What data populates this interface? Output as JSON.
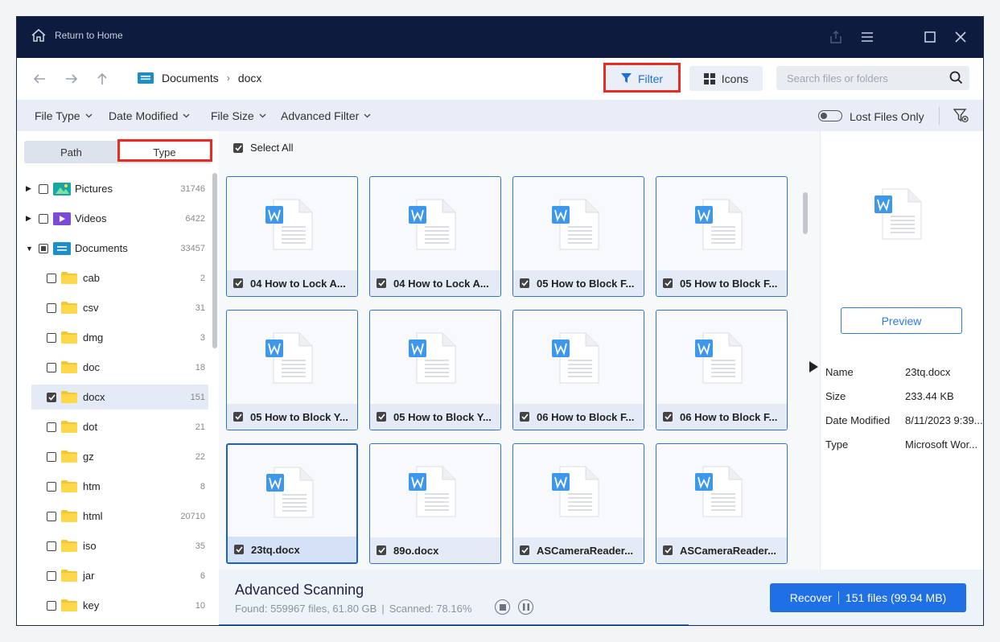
{
  "titlebar": {
    "home_label": "Return to Home"
  },
  "nav": {
    "breadcrumbs": [
      "Documents",
      "docx"
    ],
    "filter_label": "Filter",
    "icons_label": "Icons",
    "search_placeholder": "Search files or folders"
  },
  "filters": {
    "items": [
      "File Type",
      "Date Modified",
      "File Size",
      "Advanced Filter"
    ],
    "lost_files_only": "Lost Files Only"
  },
  "sidebar": {
    "tabs": [
      "Path",
      "Type"
    ],
    "active_tab": "Type",
    "tree": [
      {
        "label": "Pictures",
        "count": "31746"
      },
      {
        "label": "Videos",
        "count": "6422"
      },
      {
        "label": "Documents",
        "count": "33457"
      }
    ],
    "folders": [
      {
        "label": "cab",
        "count": "2"
      },
      {
        "label": "csv",
        "count": "31"
      },
      {
        "label": "dmg",
        "count": "3"
      },
      {
        "label": "doc",
        "count": "18"
      },
      {
        "label": "docx",
        "count": "151"
      },
      {
        "label": "dot",
        "count": "21"
      },
      {
        "label": "gz",
        "count": "22"
      },
      {
        "label": "htm",
        "count": "8"
      },
      {
        "label": "html",
        "count": "20710"
      },
      {
        "label": "iso",
        "count": "35"
      },
      {
        "label": "jar",
        "count": "6"
      },
      {
        "label": "key",
        "count": "10"
      }
    ]
  },
  "content": {
    "select_all": "Select All",
    "files": [
      "04 How to Lock A...",
      "04 How to Lock A...",
      "05 How to Block F...",
      "05 How to Block F...",
      "05 How to Block Y...",
      "05 How to Block Y...",
      "06 How to Block F...",
      "06 How to Block F...",
      "23tq.docx",
      "89o.docx",
      "ASCameraReader...",
      "ASCameraReader..."
    ]
  },
  "details": {
    "preview_label": "Preview",
    "rows": [
      {
        "key": "Name",
        "value": "23tq.docx"
      },
      {
        "key": "Size",
        "value": "233.44 KB"
      },
      {
        "key": "Date Modified",
        "value": "8/11/2023 9:39..."
      },
      {
        "key": "Type",
        "value": "Microsoft Wor..."
      }
    ]
  },
  "footer": {
    "title": "Advanced Scanning",
    "found": "Found: 559967 files, 61.80 GB",
    "sep": "|",
    "scanned": "Scanned: 78.16%",
    "scan_progress": 0.7816,
    "recover_label": "Recover",
    "recover_info": "151 files (99.94 MB)"
  },
  "colors": {
    "accent": "#1f6fe5",
    "titlebar": "#0d1b3e",
    "highlight": "#ea2b24"
  }
}
